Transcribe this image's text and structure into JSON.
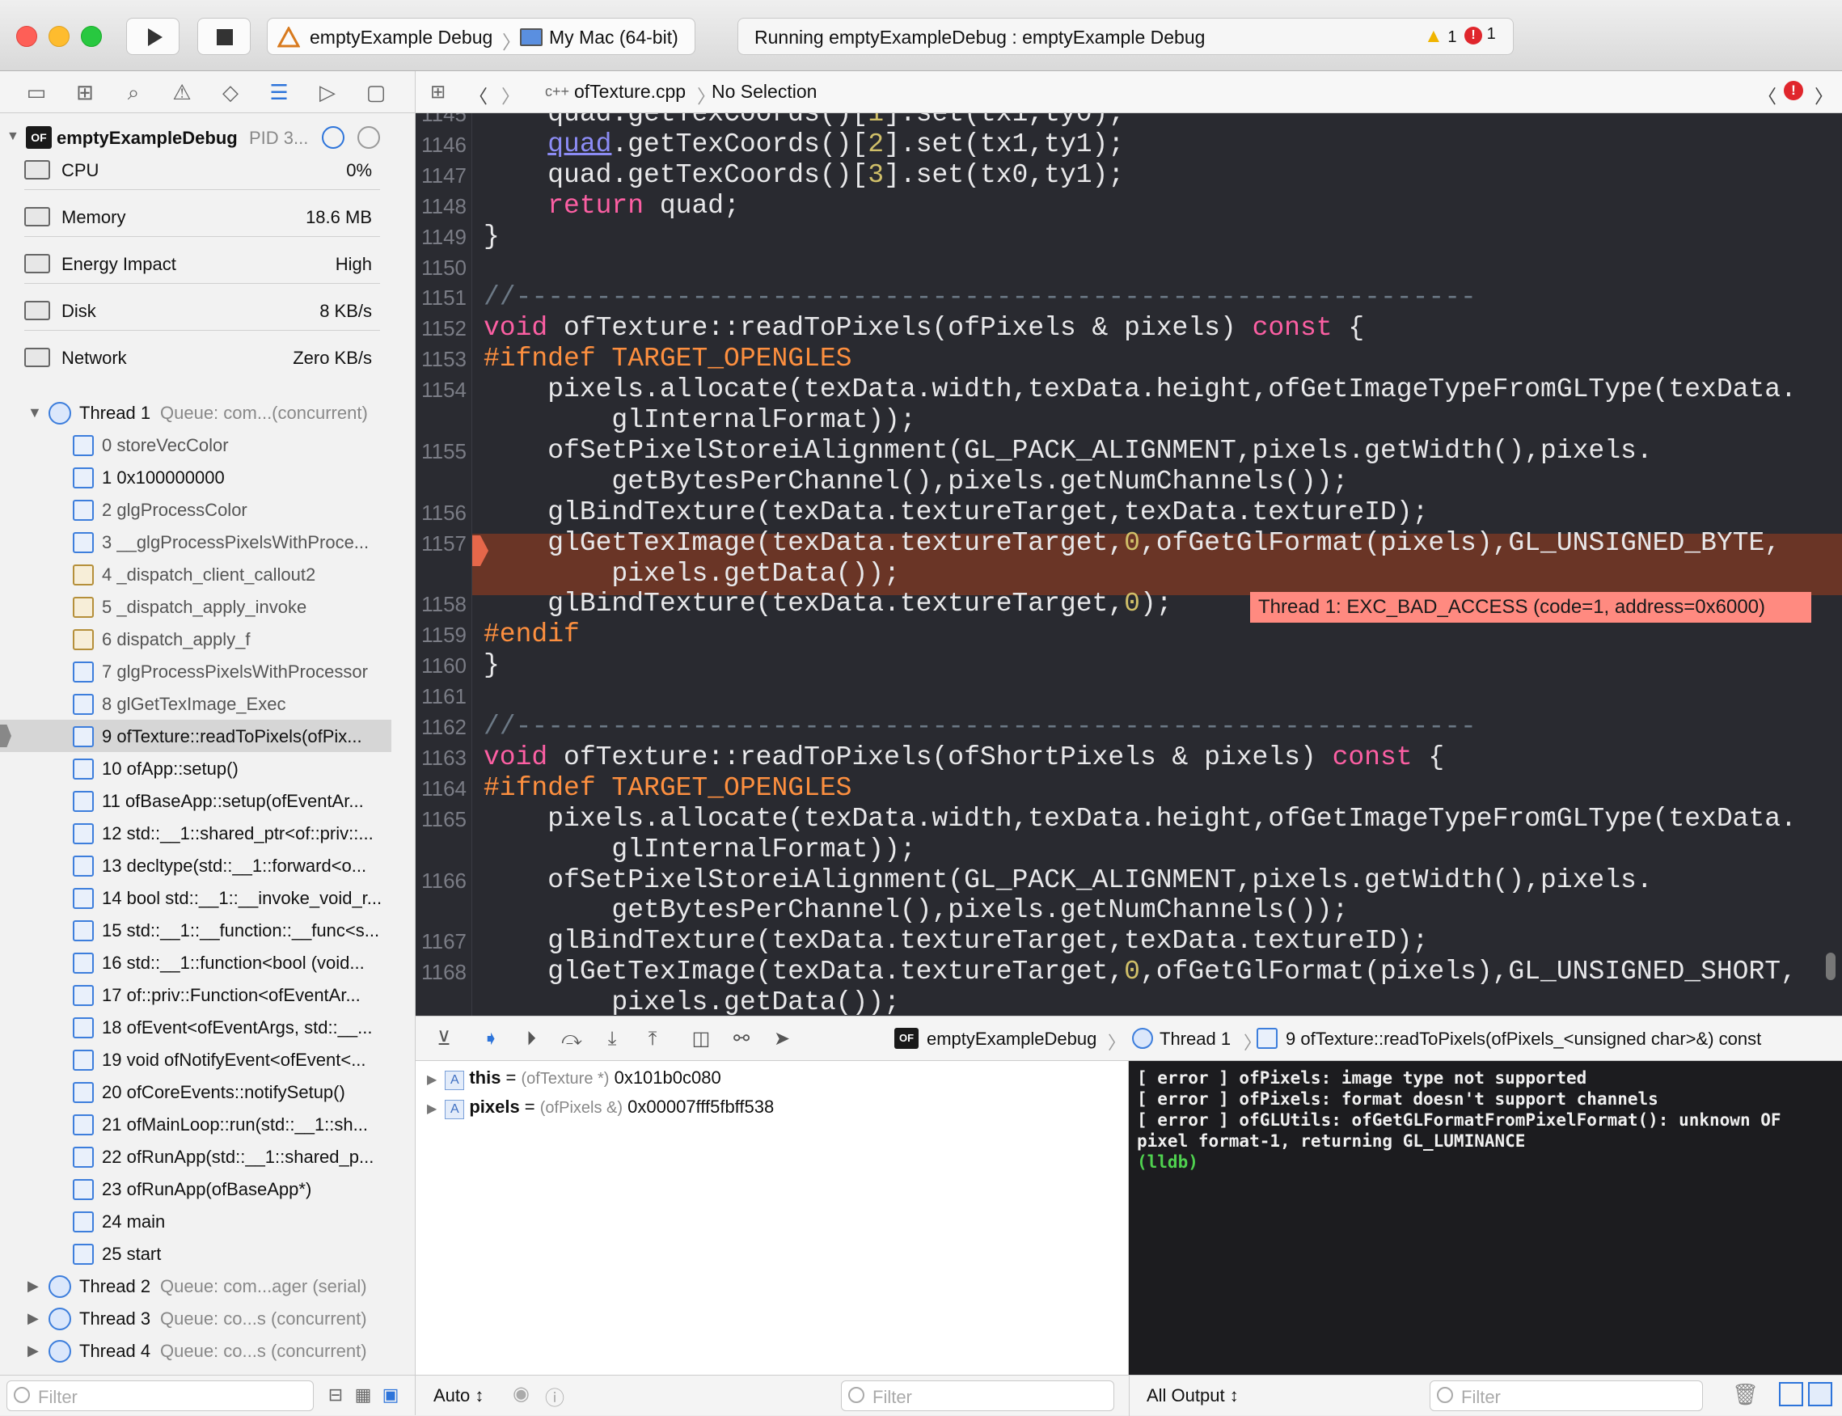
{
  "toolbar": {
    "scheme_name": "emptyExample Debug",
    "destination": "My Mac (64-bit)",
    "activity": "Running emptyExampleDebug : emptyExample Debug",
    "warnings": "1",
    "errors": "1"
  },
  "navigator": {
    "process": {
      "name": "emptyExampleDebug",
      "pid": "PID 3..."
    },
    "gauges": [
      {
        "label": "CPU",
        "value": "0%"
      },
      {
        "label": "Memory",
        "value": "18.6 MB"
      },
      {
        "label": "Energy Impact",
        "value": "High"
      },
      {
        "label": "Disk",
        "value": "8 KB/s"
      },
      {
        "label": "Network",
        "value": "Zero KB/s"
      }
    ],
    "thread1": {
      "name": "Thread 1",
      "queue": "Queue: com...(concurrent)"
    },
    "frames": [
      "0 storeVecColor",
      "1 0x100000000",
      "2 glgProcessColor",
      "3 __glgProcessPixelsWithProce...",
      "4 _dispatch_client_callout2",
      "5 _dispatch_apply_invoke",
      "6 dispatch_apply_f",
      "7 glgProcessPixelsWithProcessor",
      "8 glGetTexImage_Exec",
      "9 ofTexture::readToPixels(ofPix...",
      "10 ofApp::setup()",
      "11 ofBaseApp::setup(ofEventAr...",
      "12 std::__1::shared_ptr<of::priv::...",
      "13 decltype(std::__1::forward<o...",
      "14 bool std::__1::__invoke_void_r...",
      "15 std::__1::__function::__func<s...",
      "16 std::__1::function<bool (void...",
      "17 of::priv::Function<ofEventAr...",
      "18 ofEvent<ofEventArgs, std::__...",
      "19 void ofNotifyEvent<ofEvent<...",
      "20 ofCoreEvents::notifySetup()",
      "21 ofMainLoop::run(std::__1::sh...",
      "22 ofRunApp(std::__1::shared_p...",
      "23 ofRunApp(ofBaseApp*)",
      "24 main",
      "25 start"
    ],
    "other_threads": [
      {
        "name": "Thread 2",
        "queue": "Queue: com...ager (serial)"
      },
      {
        "name": "Thread 3",
        "queue": "Queue: co...s (concurrent)"
      },
      {
        "name": "Thread 4",
        "queue": "Queue: co...s (concurrent)"
      }
    ],
    "filter_placeholder": "Filter"
  },
  "jumpbar": {
    "file": "ofTexture.cpp",
    "selection": "No Selection"
  },
  "editor": {
    "error_banner": "Thread 1: EXC_BAD_ACCESS (code=1, address=0x6000)",
    "lines": [
      {
        "n": "1145",
        "html": "    quad.getTexCoords()[<span class=\"num\">1</span>].set(tx1,ty0);"
      },
      {
        "n": "1146",
        "html": "    <span style=\"color:#8c8cf5;text-decoration:underline\">quad</span>.getTexCoords()[<span class=\"num\">2</span>].set(tx1,ty1);"
      },
      {
        "n": "1147",
        "html": "    quad.getTexCoords()[<span class=\"num\">3</span>].set(tx0,ty1);"
      },
      {
        "n": "1148",
        "html": "    <span class=\"kw\">return</span> quad;"
      },
      {
        "n": "1149",
        "html": "}"
      },
      {
        "n": "1150",
        "html": ""
      },
      {
        "n": "1151",
        "html": "<span class=\"cm\">//------------------------------------------------------------</span>"
      },
      {
        "n": "1152",
        "html": "<span class=\"kw\">void</span> ofTexture::readToPixels(ofPixels &amp; pixels) <span class=\"kw\">const</span> {"
      },
      {
        "n": "1153",
        "html": "<span class=\"pp\">#ifndef TARGET_OPENGLES</span>"
      },
      {
        "n": "1154",
        "html": "    pixels.allocate(texData.width,texData.height,ofGetImageTypeFromGLType(texData.\n        glInternalFormat));"
      },
      {
        "n": "1155",
        "html": "    ofSetPixelStoreiAlignment(GL_PACK_ALIGNMENT,pixels.getWidth(),pixels.\n        getBytesPerChannel(),pixels.getNumChannels());"
      },
      {
        "n": "1156",
        "html": "    glBindTexture(texData.textureTarget,texData.textureID);"
      },
      {
        "n": "1157",
        "html": "    glGetTexImage(texData.textureTarget,<span class=\"num\">0</span>,ofGetGlFormat(pixels),GL_UNSIGNED_BYTE,\n        pixels.getData());"
      },
      {
        "n": "1158",
        "html": "    glBindTexture(texData.textureTarget,<span class=\"num\">0</span>);"
      },
      {
        "n": "1159",
        "html": "<span class=\"pp\">#endif</span>"
      },
      {
        "n": "1160",
        "html": "}"
      },
      {
        "n": "1161",
        "html": ""
      },
      {
        "n": "1162",
        "html": "<span class=\"cm\">//------------------------------------------------------------</span>"
      },
      {
        "n": "1163",
        "html": "<span class=\"kw\">void</span> ofTexture::readToPixels(ofShortPixels &amp; pixels) <span class=\"kw\">const</span> {"
      },
      {
        "n": "1164",
        "html": "<span class=\"pp\">#ifndef TARGET_OPENGLES</span>"
      },
      {
        "n": "1165",
        "html": "    pixels.allocate(texData.width,texData.height,ofGetImageTypeFromGLType(texData.\n        glInternalFormat));"
      },
      {
        "n": "1166",
        "html": "    ofSetPixelStoreiAlignment(GL_PACK_ALIGNMENT,pixels.getWidth(),pixels.\n        getBytesPerChannel(),pixels.getNumChannels());"
      },
      {
        "n": "1167",
        "html": "    glBindTexture(texData.textureTarget,texData.textureID);"
      },
      {
        "n": "1168",
        "html": "    glGetTexImage(texData.textureTarget,<span class=\"num\">0</span>,ofGetGlFormat(pixels),GL_UNSIGNED_SHORT,\n        pixels.getData());"
      }
    ]
  },
  "debugbar": {
    "process": "emptyExampleDebug",
    "thread": "Thread 1",
    "frame": "9 ofTexture::readToPixels(ofPixels_<unsigned char>&) const"
  },
  "variables": [
    {
      "name": "this",
      "type": "(ofTexture *)",
      "value": "0x101b0c080"
    },
    {
      "name": "pixels",
      "type": "(ofPixels &)",
      "value": "0x00007fff5fbff538"
    }
  ],
  "console": {
    "lines": [
      "[ error ] ofPixels: image type not supported",
      "[ error ] ofPixels: format doesn't support channels",
      "[ error ] ofGLUtils: ofGetGLFormatFromPixelFormat(): unknown OF pixel format-1, returning GL_LUMINANCE"
    ],
    "prompt": "(lldb)"
  },
  "footer": {
    "auto_label": "Auto ↕",
    "all_output_label": "All Output ↕",
    "filter_placeholder": "Filter"
  },
  "colors": {
    "error_line": "#6a3526",
    "error_banner": "#ff8a80",
    "editor_bg": "#292a30"
  }
}
